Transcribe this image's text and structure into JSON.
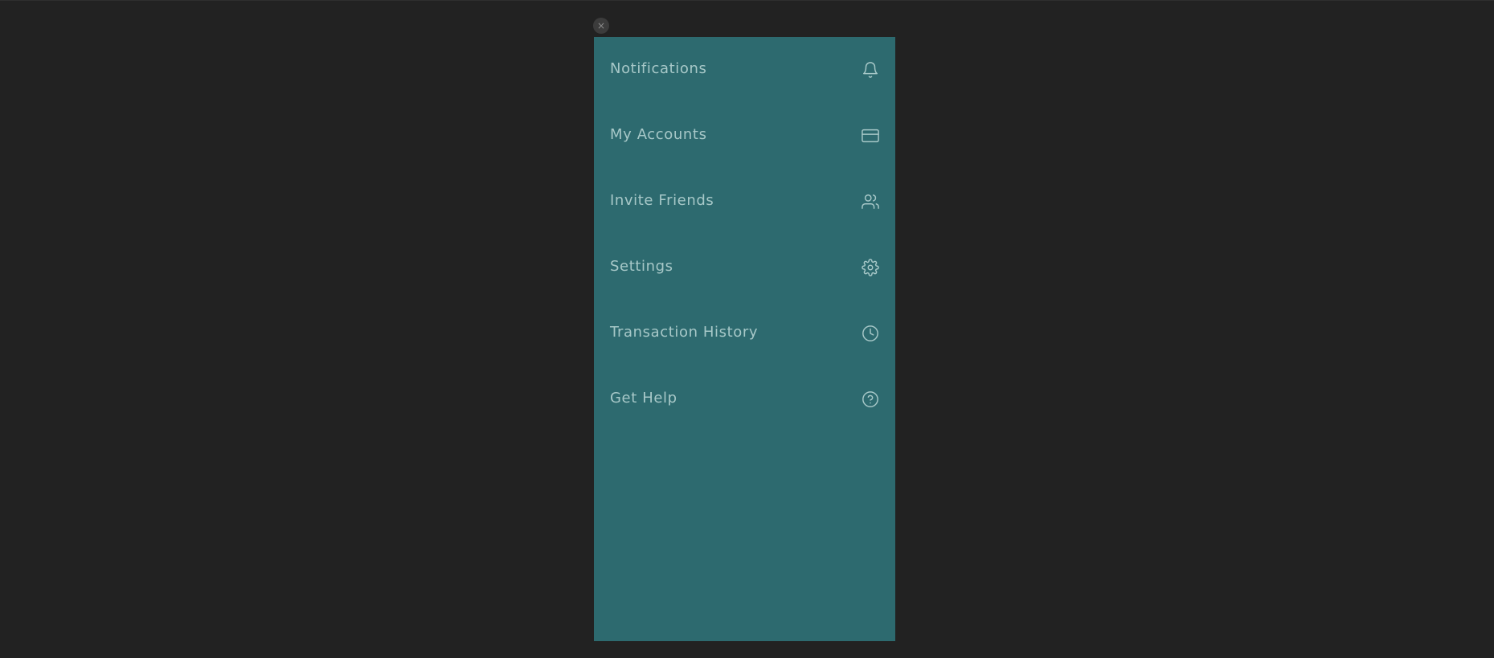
{
  "close_button": {
    "glyph": "×"
  },
  "menu": {
    "background_color": "#2d6a6f",
    "text_color": "#a7c8c8",
    "items": [
      {
        "label": "Notifications",
        "icon": "bell-icon"
      },
      {
        "label": "My Accounts",
        "icon": "credit-card-icon"
      },
      {
        "label": "Invite Friends",
        "icon": "users-icon"
      },
      {
        "label": "Settings",
        "icon": "gear-icon"
      },
      {
        "label": "Transaction History",
        "icon": "clock-icon"
      },
      {
        "label": "Get Help",
        "icon": "help-circle-icon"
      }
    ]
  }
}
